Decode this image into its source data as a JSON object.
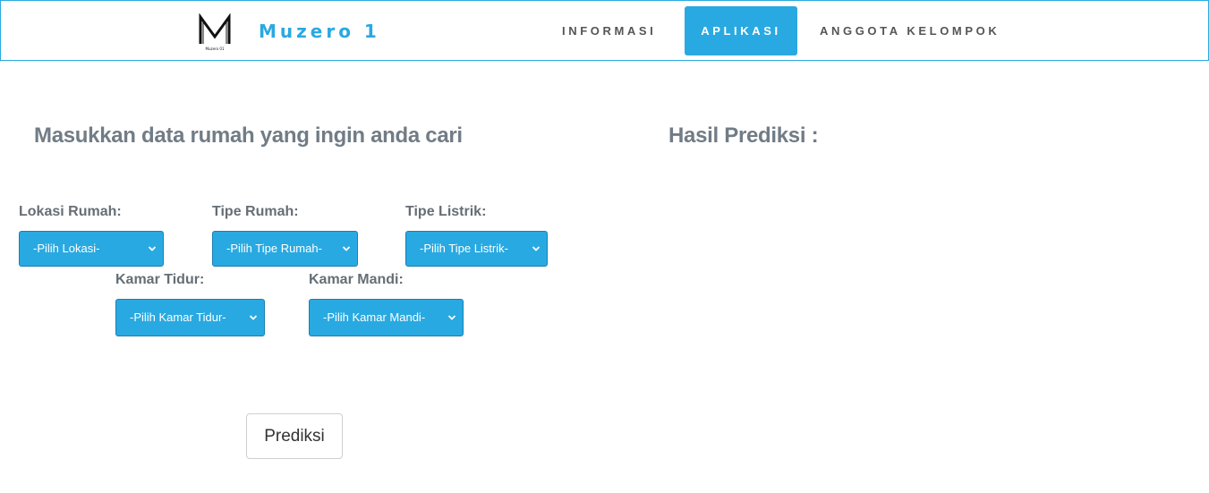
{
  "nav": {
    "logo_icon": "m-logo-icon",
    "logo_caption": "Muzero 01",
    "brand": "Muzero 1",
    "items": [
      {
        "label": "INFORMASI",
        "active": false
      },
      {
        "label": "APLIKASI",
        "active": true
      },
      {
        "label": "ANGGOTA KELOMPOK",
        "active": false
      }
    ]
  },
  "form": {
    "title": "Masukkan data rumah yang ingin anda cari",
    "fields": {
      "lokasi": {
        "label": "Lokasi Rumah:",
        "selected": "-Pilih Lokasi-"
      },
      "tipe_rumah": {
        "label": "Tipe Rumah:",
        "selected": "-Pilih Tipe Rumah-"
      },
      "tipe_listrik": {
        "label": "Tipe Listrik:",
        "selected": "-Pilih Tipe Listrik-"
      },
      "kamar_tidur": {
        "label": "Kamar Tidur:",
        "selected": "-Pilih Kamar Tidur-"
      },
      "kamar_mandi": {
        "label": "Kamar Mandi:",
        "selected": "-Pilih Kamar Mandi-"
      }
    },
    "submit_label": "Prediksi"
  },
  "result": {
    "title": "Hasil Prediksi :"
  },
  "colors": {
    "accent": "#29a9e1",
    "heading": "#717c86",
    "label": "#666e75"
  }
}
